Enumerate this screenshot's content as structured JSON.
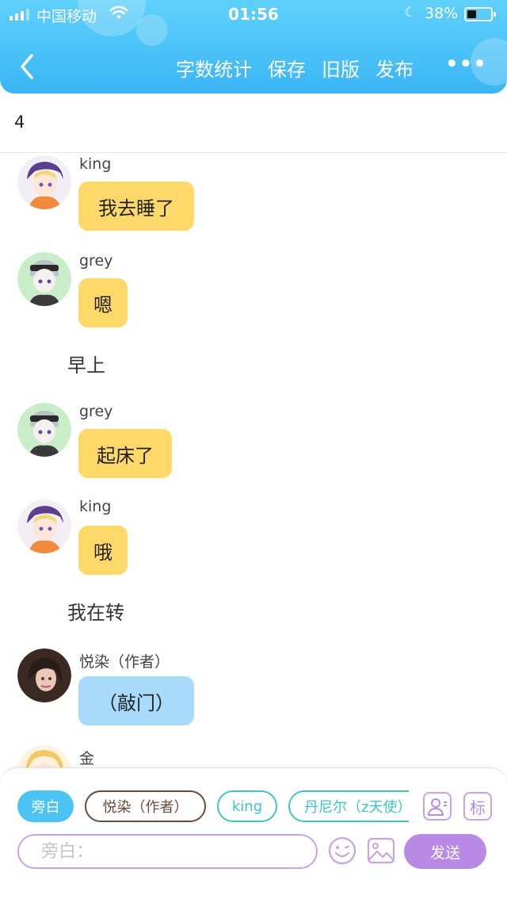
{
  "status_bar": {
    "carrier": "中国移动",
    "time": "01:56",
    "battery_percent": "38%",
    "battery_level": 0.38
  },
  "header": {
    "actions": [
      "字数统计",
      "保存",
      "旧版",
      "发布"
    ],
    "more": "•••"
  },
  "chapter": {
    "number": "4"
  },
  "messages": [
    {
      "type": "character",
      "name": "king",
      "text": "我去睡了",
      "avatar": "king-avatar",
      "bubble_color": "#ffd86a"
    },
    {
      "type": "character",
      "name": "grey",
      "text": "嗯",
      "avatar": "grey-avatar",
      "bubble_color": "#ffd86a"
    },
    {
      "type": "narration",
      "text": "早上"
    },
    {
      "type": "character",
      "name": "grey",
      "text": "起床了",
      "avatar": "grey-avatar",
      "bubble_color": "#ffd86a"
    },
    {
      "type": "character",
      "name": "king",
      "text": "哦",
      "avatar": "king-avatar",
      "bubble_color": "#ffd86a"
    },
    {
      "type": "narration",
      "text": "我在转"
    },
    {
      "type": "character",
      "name": "悦染（作者）",
      "text": "（敲门）",
      "avatar": "author-avatar",
      "bubble_color": "#a8dbfb"
    },
    {
      "type": "character",
      "name": "金",
      "text": "",
      "avatar": "jin-avatar"
    }
  ],
  "composer": {
    "chips": [
      "旁白",
      "悦染（作者）",
      "king",
      "丹尼尔（z天使）"
    ],
    "tag_button": "标",
    "input_placeholder": "旁白：",
    "send_label": "发送"
  },
  "colors": {
    "header": "#3ab6f5",
    "bubble_yellow": "#ffd86a",
    "bubble_blue": "#a8dbfb",
    "send": "#b88ae6",
    "accent_purple": "#c7a3e6"
  }
}
